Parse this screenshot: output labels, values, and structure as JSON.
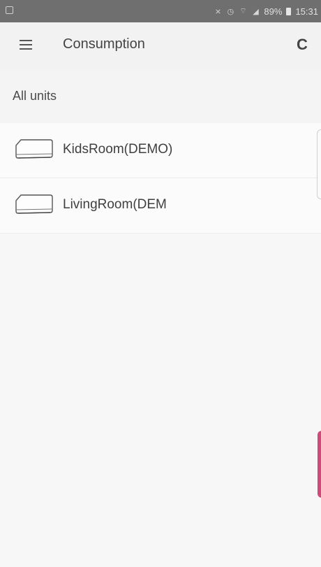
{
  "status_bar": {
    "battery_percent": "89%",
    "time": "15:31",
    "icons": [
      "mute-icon",
      "alarm-icon",
      "wifi-icon",
      "signal-icon",
      "battery-icon"
    ]
  },
  "app_bar": {
    "title": "Consumption",
    "menu_icon": "menu-icon",
    "refresh_icon": "refresh-icon",
    "refresh_glyph": "C"
  },
  "section": {
    "title": "All units"
  },
  "units": [
    {
      "name": "KidsRoom(DEMO)",
      "icon": "air-conditioner-icon"
    },
    {
      "name": "LivingRoom(DEM",
      "icon": "air-conditioner-icon"
    }
  ],
  "colors": {
    "status_bar": "#6f6f6f",
    "background": "#f4f4f4",
    "accent_edge": "#d04a79"
  }
}
